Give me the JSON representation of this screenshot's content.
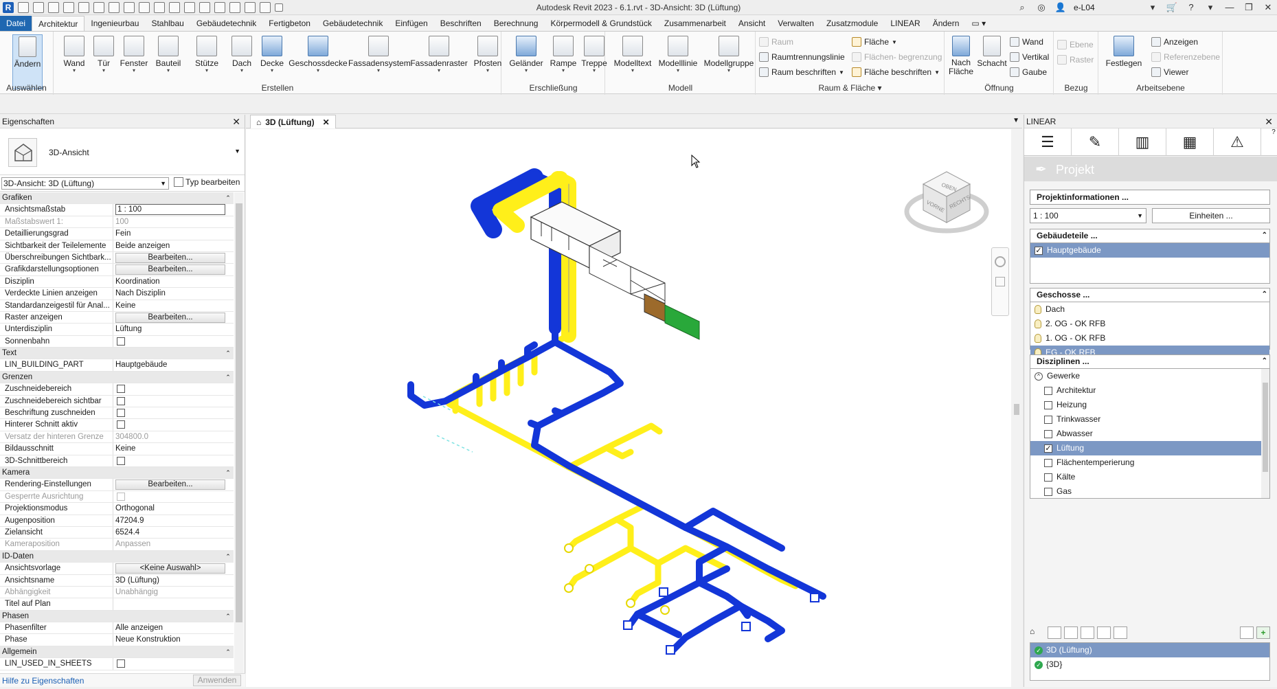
{
  "titlebar": {
    "title": "Autodesk Revit 2023 - 6.1.rvt - 3D-Ansicht: 3D (Lüftung)",
    "user": "e-L04"
  },
  "menu": [
    "Datei",
    "Architektur",
    "Ingenieurbau",
    "Stahlbau",
    "Gebäudetechnik",
    "Fertigbeton",
    "Gebäudetechnik",
    "Einfügen",
    "Beschriften",
    "Berechnung",
    "Körpermodell & Grundstück",
    "Zusammenarbeit",
    "Ansicht",
    "Verwalten",
    "Zusatzmodule",
    "LINEAR",
    "Ändern"
  ],
  "ribbon": {
    "select": {
      "label": "Ändern",
      "panel": "Auswählen"
    },
    "create": [
      "Wand",
      "Tür",
      "Fenster",
      "Bauteil",
      "Stütze",
      "Dach",
      "Decke",
      "Geschossdecke",
      "Fassadensystem",
      "Fassadenraster",
      "Pfosten"
    ],
    "create_panel": "Erstellen",
    "circ": [
      "Geländer",
      "Rampe",
      "Treppe"
    ],
    "circ_panel": "Erschließung",
    "model": [
      "Modelltext",
      "Modelllinie",
      "Modellgruppe"
    ],
    "model_panel": "Modell",
    "room": {
      "raum": "Raum",
      "raumtrenn": "Raumtrennungslinie",
      "raum_beschr": "Raum beschriften",
      "flaeche": "Fläche",
      "flaechen_begr": "Flächen- begrenzung",
      "flaeche_beschr": "Fläche beschriften",
      "panel": "Raum & Fläche"
    },
    "opening": {
      "nach": "Nach Fläche",
      "schacht": "Schacht",
      "wand": "Wand",
      "vertikal": "Vertikal",
      "gaube": "Gaube",
      "panel": "Öffnung"
    },
    "datum": {
      "ebene": "Ebene",
      "raster": "Raster",
      "panel": "Bezug"
    },
    "work": {
      "festlegen": "Festlegen",
      "anzeigen": "Anzeigen",
      "ref": "Referenzebene",
      "viewer": "Viewer",
      "panel": "Arbeitsebene"
    }
  },
  "props": {
    "title": "Eigenschaften",
    "type_name": "3D-Ansicht",
    "instance": "3D-Ansicht: 3D (Lüftung)",
    "edit_type": "Typ bearbeiten",
    "rows": [
      {
        "g": "Grafiken"
      },
      {
        "k": "Ansichtsmaßstab",
        "v": "1 : 100",
        "t": "input"
      },
      {
        "k": "Maßstabswert 1:",
        "v": "100",
        "d": true
      },
      {
        "k": "Detaillierungsgrad",
        "v": "Fein"
      },
      {
        "k": "Sichtbarkeit der Teilelemente",
        "v": "Beide anzeigen"
      },
      {
        "k": "Überschreibungen Sichtbark...",
        "v": "Bearbeiten...",
        "t": "btn"
      },
      {
        "k": "Grafikdarstellungsoptionen",
        "v": "Bearbeiten...",
        "t": "btn"
      },
      {
        "k": "Disziplin",
        "v": "Koordination"
      },
      {
        "k": "Verdeckte Linien anzeigen",
        "v": "Nach Disziplin"
      },
      {
        "k": "Standardanzeigestil für Anal...",
        "v": "Keine"
      },
      {
        "k": "Raster anzeigen",
        "v": "Bearbeiten...",
        "t": "btn"
      },
      {
        "k": "Unterdisziplin",
        "v": "Lüftung"
      },
      {
        "k": "Sonnenbahn",
        "v": "",
        "t": "cb"
      },
      {
        "g": "Text"
      },
      {
        "k": "LIN_BUILDING_PART",
        "v": "Hauptgebäude"
      },
      {
        "g": "Grenzen"
      },
      {
        "k": "Zuschneidebereich",
        "v": "",
        "t": "cb"
      },
      {
        "k": "Zuschneidebereich sichtbar",
        "v": "",
        "t": "cb"
      },
      {
        "k": "Beschriftung zuschneiden",
        "v": "",
        "t": "cb"
      },
      {
        "k": "Hinterer Schnitt aktiv",
        "v": "",
        "t": "cb"
      },
      {
        "k": "Versatz der hinteren Grenze",
        "v": "304800.0",
        "d": true
      },
      {
        "k": "Bildausschnitt",
        "v": "Keine"
      },
      {
        "k": "3D-Schnittbereich",
        "v": "",
        "t": "cb"
      },
      {
        "g": "Kamera"
      },
      {
        "k": "Rendering-Einstellungen",
        "v": "Bearbeiten...",
        "t": "btn"
      },
      {
        "k": "Gesperrte Ausrichtung",
        "v": "",
        "t": "cb",
        "d": true
      },
      {
        "k": "Projektionsmodus",
        "v": "Orthogonal"
      },
      {
        "k": "Augenposition",
        "v": "47204.9"
      },
      {
        "k": "Zielansicht",
        "v": "6524.4"
      },
      {
        "k": "Kameraposition",
        "v": "Anpassen",
        "d": true
      },
      {
        "g": "ID-Daten"
      },
      {
        "k": "Ansichtsvorlage",
        "v": "<Keine Auswahl>",
        "t": "btn"
      },
      {
        "k": "Ansichtsname",
        "v": "3D (Lüftung)"
      },
      {
        "k": "Abhängigkeit",
        "v": "Unabhängig",
        "d": true
      },
      {
        "k": "Titel auf Plan",
        "v": ""
      },
      {
        "g": "Phasen"
      },
      {
        "k": "Phasenfilter",
        "v": "Alle anzeigen"
      },
      {
        "k": "Phase",
        "v": "Neue Konstruktion"
      },
      {
        "g": "Allgemein"
      },
      {
        "k": "LIN_USED_IN_SHEETS",
        "v": "",
        "t": "cb"
      }
    ],
    "help": "Hilfe zu Eigenschaften",
    "apply": "Anwenden"
  },
  "view": {
    "tab": "3D (Lüftung)"
  },
  "viewcube": {
    "top": "OBEN",
    "front": "VORNE",
    "right": "RECHTS"
  },
  "linear": {
    "title": "LINEAR",
    "project": "Projekt",
    "proj_info": "Projektinformationen ...",
    "scale": "1 : 100",
    "units": "Einheiten ...",
    "parts_head": "Gebäudeteile ...",
    "parts": [
      "Hauptgebäude"
    ],
    "levels_head": "Geschosse ...",
    "levels": [
      "Dach",
      "2. OG - OK RFB",
      "1. OG - OK RFB",
      "EG - OK RFB"
    ],
    "disc_head": "Disziplinen ...",
    "disc_root": "Gewerke",
    "disciplines": [
      "Architektur",
      "Heizung",
      "Trinkwasser",
      "Abwasser",
      "Lüftung",
      "Flächentemperierung",
      "Kälte",
      "Gas"
    ],
    "views": [
      "3D (Lüftung)",
      "{3D}"
    ]
  }
}
